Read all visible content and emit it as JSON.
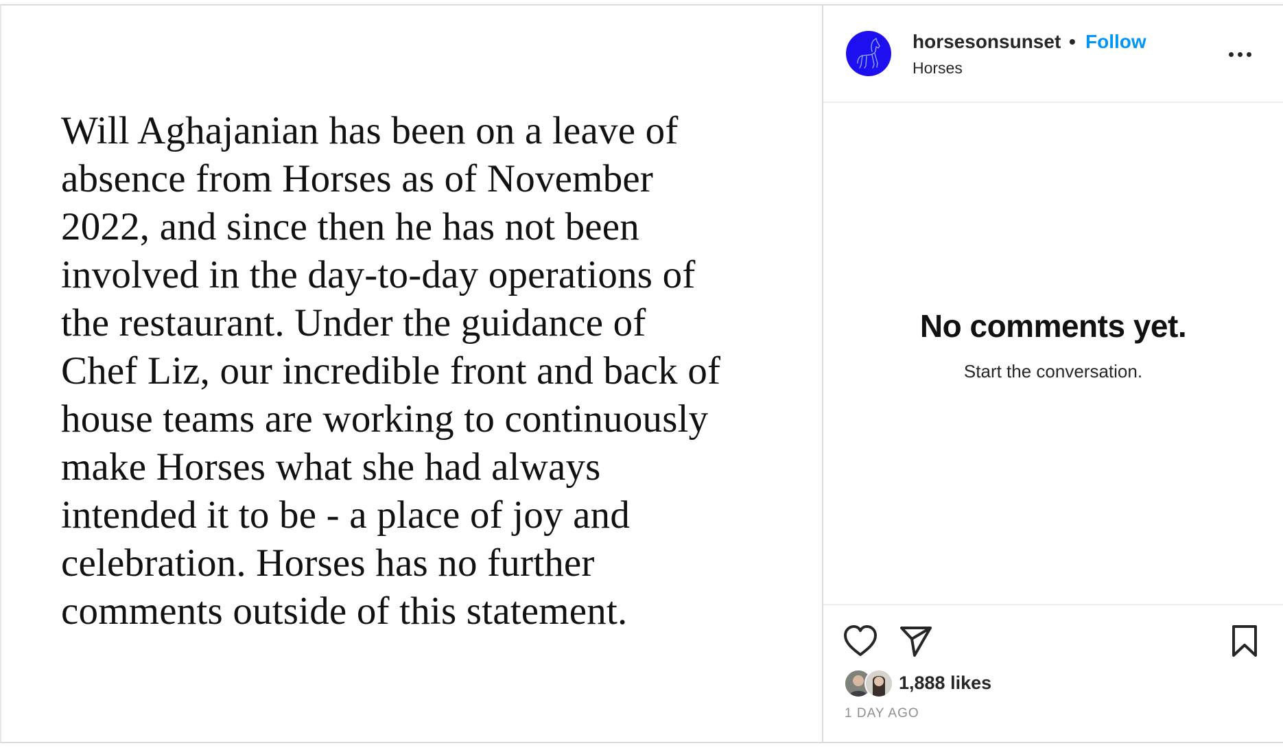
{
  "post": {
    "statement_text": "Will Aghajanian has been on a leave of\nabsence from Horses as of November\n2022, and since then he has not been\ninvolved in the day-to-day operations of\nthe restaurant.  Under the guidance of\nChef Liz, our incredible front and back of\nhouse teams are working to continuously\nmake Horses what she had always\nintended it to be - a place of joy and\ncelebration.  Horses has no further\ncomments outside of this statement."
  },
  "header": {
    "username": "horsesonsunset",
    "separator": "•",
    "follow_label": "Follow",
    "subtitle": "Horses",
    "avatar_icon": "horse-logo-icon",
    "more_icon": "more-options-icon"
  },
  "comments": {
    "empty_title": "No comments yet.",
    "empty_subtitle": "Start the conversation."
  },
  "actions": {
    "like_icon": "heart-icon",
    "share_icon": "paper-plane-icon",
    "save_icon": "bookmark-icon"
  },
  "stats": {
    "likes_text": "1,888 likes",
    "timestamp": "1 DAY AGO"
  },
  "colors": {
    "avatar_bg": "#1e0ff0",
    "follow": "#0095f6",
    "text": "#262626",
    "muted": "#8e8e8e",
    "border": "#dbdbdb"
  }
}
